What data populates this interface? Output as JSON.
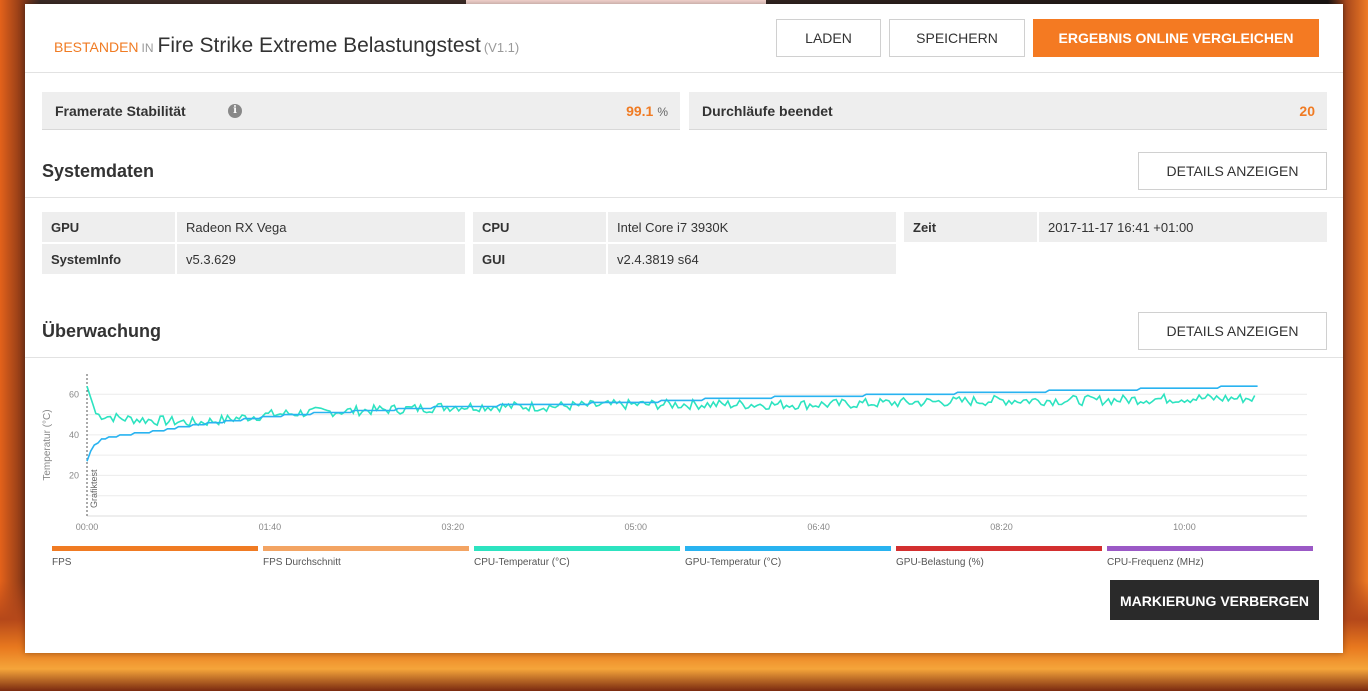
{
  "header": {
    "status": "BESTANDEN",
    "in": "IN",
    "title": "Fire Strike Extreme Belastungstest",
    "version": "(V1.1)",
    "buttons": {
      "load": "LADEN",
      "save": "SPEICHERN",
      "compare": "ERGEBNIS ONLINE VERGLEICHEN"
    }
  },
  "stats": {
    "stability": {
      "label": "Framerate Stabilität",
      "value": "99.1",
      "unit": "%"
    },
    "loops": {
      "label": "Durchläufe beendet",
      "value": "20"
    }
  },
  "system": {
    "title": "Systemdaten",
    "details_button": "DETAILS ANZEIGEN",
    "rows": [
      {
        "key": "GPU",
        "value": "Radeon RX Vega"
      },
      {
        "key": "SystemInfo",
        "value": "v5.3.629"
      },
      {
        "key": "CPU",
        "value": "Intel Core i7 3930K"
      },
      {
        "key": "GUI",
        "value": "v2.4.3819 s64"
      },
      {
        "key": "Zeit",
        "value": "2017-11-17 16:41 +01:00"
      }
    ]
  },
  "monitoring": {
    "title": "Überwachung",
    "details_button": "DETAILS ANZEIGEN",
    "hide_markers_button": "MARKIERUNG VERBERGEN"
  },
  "chart_data": {
    "type": "line",
    "ylabel": "Temperatur (°C)",
    "marker_label": "Grafiktest",
    "yticks": [
      20,
      40,
      60
    ],
    "ylim": [
      0,
      70
    ],
    "xticks": [
      "00:00",
      "01:40",
      "03:20",
      "05:00",
      "06:40",
      "08:20",
      "10:00"
    ],
    "xlim_seconds": [
      0,
      667
    ],
    "grid": true,
    "series": [
      {
        "name": "CPU-Temperatur (°C)",
        "color": "#2de3c0",
        "x": [
          0,
          5,
          20,
          40,
          60,
          80,
          100,
          120,
          150,
          180,
          200,
          250,
          300,
          350,
          400,
          450,
          500,
          550,
          600,
          640
        ],
        "y": [
          64,
          50,
          48,
          47,
          46,
          48,
          50,
          51,
          52,
          53,
          54,
          54,
          55,
          55,
          55,
          56,
          57,
          57,
          58,
          58
        ]
      },
      {
        "name": "GPU-Temperatur (°C)",
        "color": "#29b3f0",
        "x": [
          0,
          3,
          8,
          20,
          40,
          60,
          80,
          100,
          130,
          160,
          200,
          250,
          300,
          350,
          400,
          450,
          500,
          550,
          600,
          640
        ],
        "y": [
          27,
          34,
          38,
          40,
          42,
          45,
          47,
          49,
          51,
          52,
          54,
          55,
          56,
          58,
          59,
          60,
          61,
          62,
          63,
          64
        ]
      }
    ]
  },
  "legend": [
    {
      "label": "FPS",
      "color": "#f07b23"
    },
    {
      "label": "FPS Durchschnitt",
      "color": "#f3a463"
    },
    {
      "label": "CPU-Temperatur (°C)",
      "color": "#2de3c0"
    },
    {
      "label": "GPU-Temperatur (°C)",
      "color": "#29b3f0"
    },
    {
      "label": "GPU-Belastung (%)",
      "color": "#d32f2f"
    },
    {
      "label": "CPU-Frequenz (MHz)",
      "color": "#9b59c6"
    }
  ]
}
